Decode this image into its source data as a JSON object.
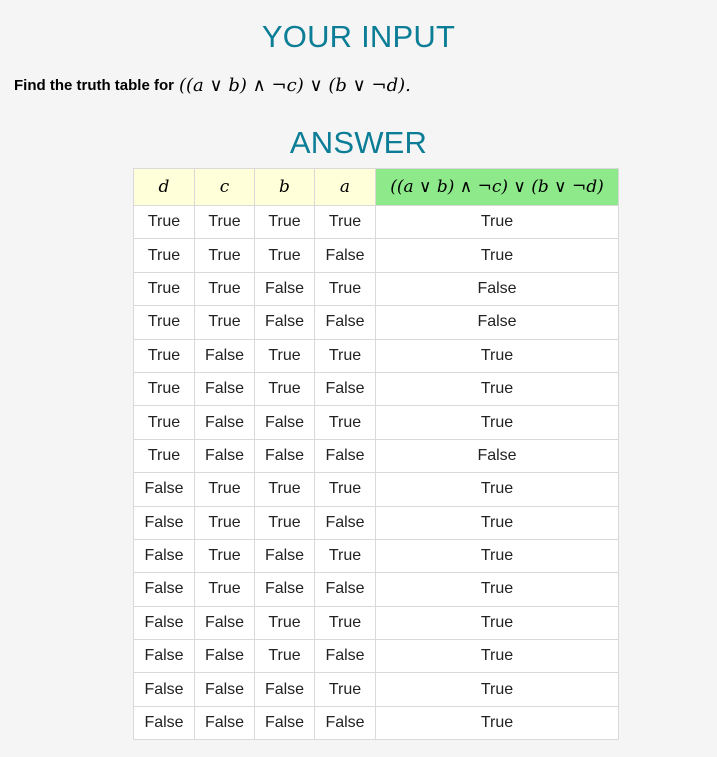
{
  "input_heading": "YOUR INPUT",
  "question": {
    "prompt": "Find the truth table for",
    "expression": "((a ∨ b) ∧ ¬c) ∨ (b ∨ ¬d)."
  },
  "answer_heading": "ANSWER",
  "table": {
    "headers": [
      "d",
      "c",
      "b",
      "a",
      "((a ∨ b) ∧ ¬c) ∨ (b ∨ ¬d)"
    ],
    "rows": [
      [
        "True",
        "True",
        "True",
        "True",
        "True"
      ],
      [
        "True",
        "True",
        "True",
        "False",
        "True"
      ],
      [
        "True",
        "True",
        "False",
        "True",
        "False"
      ],
      [
        "True",
        "True",
        "False",
        "False",
        "False"
      ],
      [
        "True",
        "False",
        "True",
        "True",
        "True"
      ],
      [
        "True",
        "False",
        "True",
        "False",
        "True"
      ],
      [
        "True",
        "False",
        "False",
        "True",
        "True"
      ],
      [
        "True",
        "False",
        "False",
        "False",
        "False"
      ],
      [
        "False",
        "True",
        "True",
        "True",
        "True"
      ],
      [
        "False",
        "True",
        "True",
        "False",
        "True"
      ],
      [
        "False",
        "True",
        "False",
        "True",
        "True"
      ],
      [
        "False",
        "True",
        "False",
        "False",
        "True"
      ],
      [
        "False",
        "False",
        "True",
        "True",
        "True"
      ],
      [
        "False",
        "False",
        "True",
        "False",
        "True"
      ],
      [
        "False",
        "False",
        "False",
        "True",
        "True"
      ],
      [
        "False",
        "False",
        "False",
        "False",
        "True"
      ]
    ]
  },
  "colors": {
    "heading": "#0b7d96",
    "header_bg": "#ffffd9",
    "result_header_bg": "#8ee98a"
  }
}
